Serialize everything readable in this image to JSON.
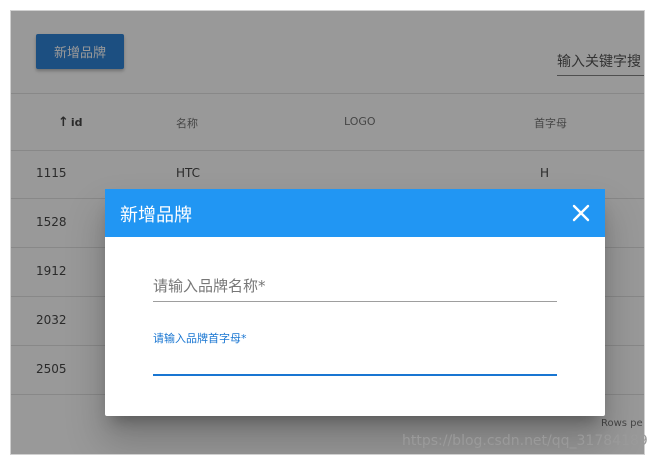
{
  "toolbar": {
    "add_label": "新增品牌",
    "search_placeholder": "输入关键字搜"
  },
  "table": {
    "headers": {
      "id": "id",
      "name": "名称",
      "logo": "LOGO",
      "letter": "首字母"
    },
    "rows": [
      {
        "id": "1115",
        "name": "HTC",
        "letter": "H"
      },
      {
        "id": "1528",
        "name": "",
        "letter": ""
      },
      {
        "id": "1912",
        "name": "",
        "letter": ""
      },
      {
        "id": "2032",
        "name": "",
        "letter": ""
      },
      {
        "id": "2505",
        "name": "",
        "letter": ""
      }
    ],
    "footer": "Rows pe"
  },
  "dialog": {
    "title": "新增品牌",
    "name_placeholder": "请输入品牌名称*",
    "letter_label": "请输入品牌首字母*"
  },
  "watermark": "https://blog.csdn.net/qq_31784189",
  "colors": {
    "primary": "#2196f3",
    "button": "#1976d2",
    "overlay": "#212121"
  },
  "icons": {
    "sort": "arrow-up-icon",
    "close": "close-icon"
  }
}
